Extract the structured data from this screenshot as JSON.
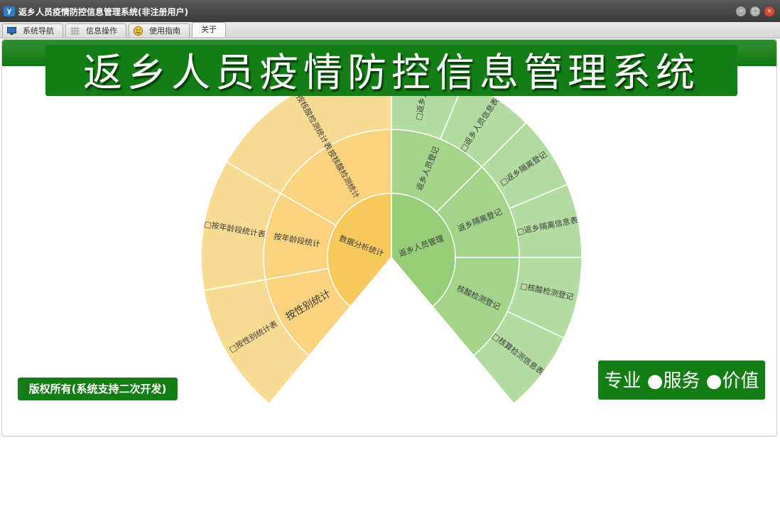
{
  "window": {
    "title": "返乡人员疫情防控信息管理系统(非注册用户)",
    "icon_letter": "y",
    "minimize_glyph": "−",
    "maximize_glyph": "□",
    "close_glyph": "×"
  },
  "tabs": [
    {
      "label": "系统导航",
      "icon": "monitor-icon"
    },
    {
      "label": "信息操作",
      "icon": "grid-icon"
    },
    {
      "label": "使用指南",
      "icon": "smile-icon"
    },
    {
      "label": "关于",
      "icon": ""
    }
  ],
  "banner": {
    "title": "返乡人员疫情防控信息管理系统"
  },
  "footer": {
    "copyright": "版权所有(系统支持二次开发)",
    "slogan": "专业 ●服务 ●价值"
  },
  "colors": {
    "brand_green": "#157d15",
    "inner_green": "#96cd78",
    "middle_green": "#a2d48a",
    "outer_green": "#b3dca0",
    "inner_orange": "#f8c95d",
    "middle_orange": "#f9d37e",
    "outer_orange": "#fadb93"
  },
  "sunburst": {
    "groups": [
      {
        "name": "返乡人员管理",
        "theme": "green",
        "children": [
          {
            "name": "返乡人员登记",
            "leaves": [
              "□返乡人员",
              "□返乡人员信息表"
            ]
          },
          {
            "name": "返乡隔离登记",
            "leaves": [
              "□返乡隔离登记",
              "□返乡隔离信息表"
            ]
          },
          {
            "name": "核酸检测登记",
            "leaves": [
              "□核酸检测登记",
              "□核算检测信息表"
            ]
          }
        ]
      },
      {
        "name": "数据分析统计",
        "theme": "orange",
        "children": [
          {
            "name": "按核酸检测统计",
            "leaves": [
              "□按核酸检测统计表"
            ]
          },
          {
            "name": "按年龄段统计",
            "leaves": [
              "□按年龄段统计表"
            ]
          },
          {
            "name": "按性别统计",
            "leaves": [
              "□按性别统计表"
            ]
          }
        ]
      }
    ]
  }
}
